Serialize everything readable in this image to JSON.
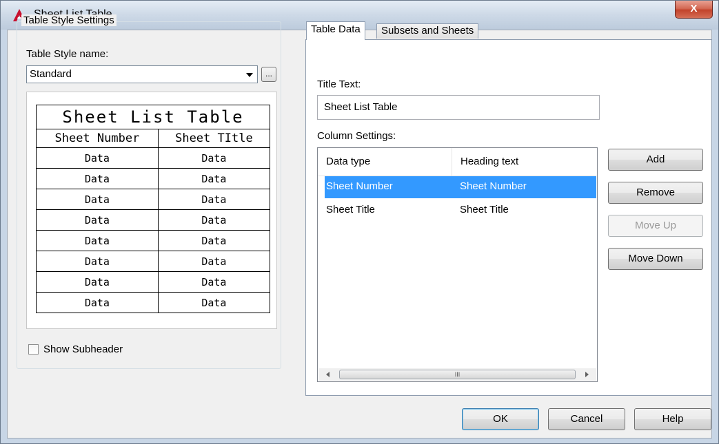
{
  "window": {
    "title": "Sheet List Table",
    "close_label": "X"
  },
  "style_settings": {
    "group_title": "Table Style Settings",
    "name_label": "Table Style name:",
    "style_value": "Standard",
    "browse_label": "...",
    "show_subheader_label": "Show Subheader",
    "show_subheader_checked": false
  },
  "preview": {
    "title": "Sheet List Table",
    "headers": [
      "Sheet Number",
      "Sheet TItle"
    ],
    "rows": [
      [
        "Data",
        "Data"
      ],
      [
        "Data",
        "Data"
      ],
      [
        "Data",
        "Data"
      ],
      [
        "Data",
        "Data"
      ],
      [
        "Data",
        "Data"
      ],
      [
        "Data",
        "Data"
      ],
      [
        "Data",
        "Data"
      ],
      [
        "Data",
        "Data"
      ]
    ]
  },
  "tabs": [
    {
      "label": "Table Data",
      "active": true
    },
    {
      "label": "Subsets and Sheets",
      "active": false
    }
  ],
  "table_data": {
    "title_text_label": "Title Text:",
    "title_text_value": "Sheet List Table",
    "column_settings_label": "Column Settings:",
    "columns": [
      "Data type",
      "Heading text"
    ],
    "rows": [
      {
        "data_type": "Sheet Number",
        "heading": "Sheet Number",
        "selected": true
      },
      {
        "data_type": "Sheet Title",
        "heading": "Sheet Title",
        "selected": false
      }
    ],
    "scroll_grip": "III"
  },
  "side_buttons": {
    "add": "Add",
    "remove": "Remove",
    "move_up": "Move Up",
    "move_down": "Move Down"
  },
  "footer": {
    "ok": "OK",
    "cancel": "Cancel",
    "help": "Help"
  },
  "colors": {
    "selection": "#3399ff",
    "logo_red": "#c8102e"
  },
  "icons": {
    "app_logo": "autocad-logo-icon",
    "dropdown": "chevron-down-icon"
  }
}
